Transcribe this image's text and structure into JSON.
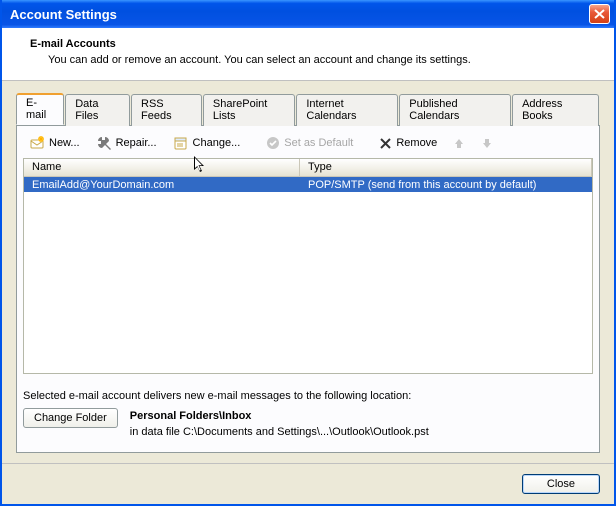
{
  "titlebar": {
    "title": "Account Settings"
  },
  "header": {
    "title": "E-mail Accounts",
    "description": "You can add or remove an account. You can select an account and change its settings."
  },
  "tabs": [
    {
      "label": "E-mail",
      "active": true
    },
    {
      "label": "Data Files",
      "active": false
    },
    {
      "label": "RSS Feeds",
      "active": false
    },
    {
      "label": "SharePoint Lists",
      "active": false
    },
    {
      "label": "Internet Calendars",
      "active": false
    },
    {
      "label": "Published Calendars",
      "active": false
    },
    {
      "label": "Address Books",
      "active": false
    }
  ],
  "toolbar": {
    "new": "New...",
    "repair": "Repair...",
    "change": "Change...",
    "set_default": "Set as Default",
    "remove": "Remove"
  },
  "list": {
    "columns": {
      "name": "Name",
      "type": "Type"
    },
    "rows": [
      {
        "name": "EmailAdd@YourDomain.com",
        "type": "POP/SMTP (send from this account by default)"
      }
    ]
  },
  "delivery": {
    "text": "Selected e-mail account delivers new e-mail messages to the following location:",
    "change_folder": "Change Folder",
    "folder_name": "Personal Folders\\Inbox",
    "folder_path": "in data file C:\\Documents and Settings\\...\\Outlook\\Outlook.pst"
  },
  "footer": {
    "close": "Close"
  }
}
